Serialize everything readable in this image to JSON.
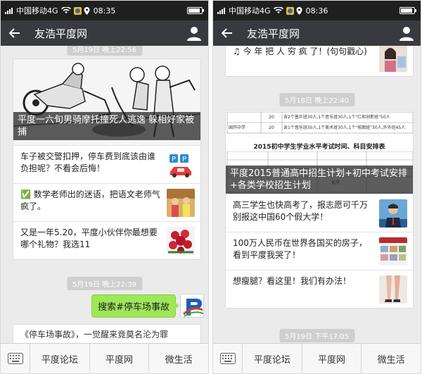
{
  "left": {
    "status": {
      "carrier": "中国移动",
      "network": "4G",
      "time": "08:35"
    },
    "nav": {
      "title": "友浩平度网"
    },
    "top_time": "5月19日 晚上22:56",
    "news_card": {
      "cover_caption": "平度一六旬男骑摩托撞死人逃逸 躲相好家被捕",
      "items": [
        {
          "text": "车子被交警扣押，停车费到底该由谁负担呢？不看会后悔！",
          "thumb": "parking-illustration"
        },
        {
          "text": "✅ 数学老师出的迷语，把语文老师气疯了。",
          "thumb": "classroom-photo"
        },
        {
          "text": "又是一年5.20，平度小伙伴你最想要哪个礼物？我选11",
          "thumb": "roses-photo"
        }
      ]
    },
    "mid_time": "5月19日 晚上22:39",
    "bubble_text": "搜索#停车场事故",
    "partial_text": "《停车场事故》，一觉醒来竟莫名沦为罪",
    "tabs": [
      "平度论坛",
      "平度网",
      "微生活"
    ]
  },
  "right": {
    "status": {
      "carrier": "中国移动",
      "network": "4G",
      "time": "08:36"
    },
    "nav": {
      "title": "友浩平度网"
    },
    "top_card_text": "♫ 今 年 把 人 穷 疯 了！(句句戳心)",
    "mid_time": "5月18日 晚上22:40",
    "news_card": {
      "table": {
        "rows": [
          {
            "school": "",
            "num": "20",
            "desc": "含2个普乒班30人,1个音乐班30人,1个\"仁和创新班\"50人"
          },
          {
            "school": "国开中学",
            "num": "20",
            "desc": "含1个音乐班30人,1个美术班30人,1个\"拓图班\"30人,外外班45人"
          }
        ],
        "schedule_title": "2015初中学生学业水平考试时间、科目安排表",
        "cell_mark": "化学"
      },
      "cover_caption": "平度2015普通高中招生计划+初中考试安排+各类学校招生计划",
      "items": [
        {
          "text": "高三学生也快高考了，报志愿可千万别报这中国60个假大学！",
          "thumb": "man-portrait"
        },
        {
          "text": "100万人民币在世界各国买的房子，看到平度我哭了！",
          "thumb": "poster-houses"
        },
        {
          "text": "想瘦腿？看这里！我们有办法！",
          "thumb": "legs-photo"
        }
      ]
    },
    "bottom_time": "5月19日 下午17:05",
    "tabs": [
      "平度论坛",
      "平度网",
      "微生活"
    ]
  }
}
